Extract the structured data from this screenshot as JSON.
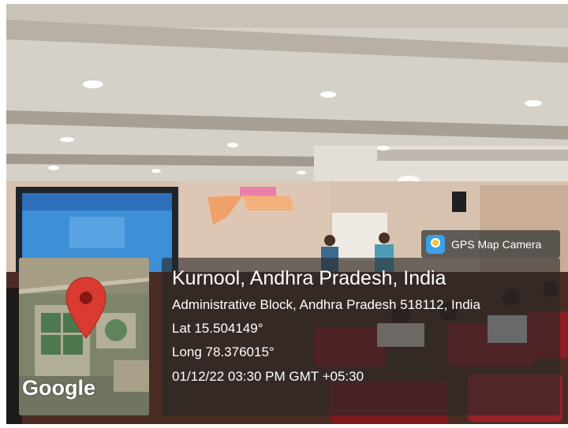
{
  "badge": {
    "label": "GPS Map Camera",
    "icon": "gps-map-camera-icon"
  },
  "location": {
    "city": "Kurnool, Andhra Pradesh, India",
    "address": "Administrative Block, Andhra Pradesh 518112, India",
    "latitude": "Lat 15.504149°",
    "longitude": "Long 78.376015°",
    "datetime": "01/12/22 03:30 PM GMT +05:30"
  },
  "map": {
    "brand": "Google",
    "pin_color": "#d93a31"
  },
  "colors": {
    "ceiling": "#d9d4cc",
    "seats": "#8e1d24",
    "screen": "#3d8fd6"
  }
}
